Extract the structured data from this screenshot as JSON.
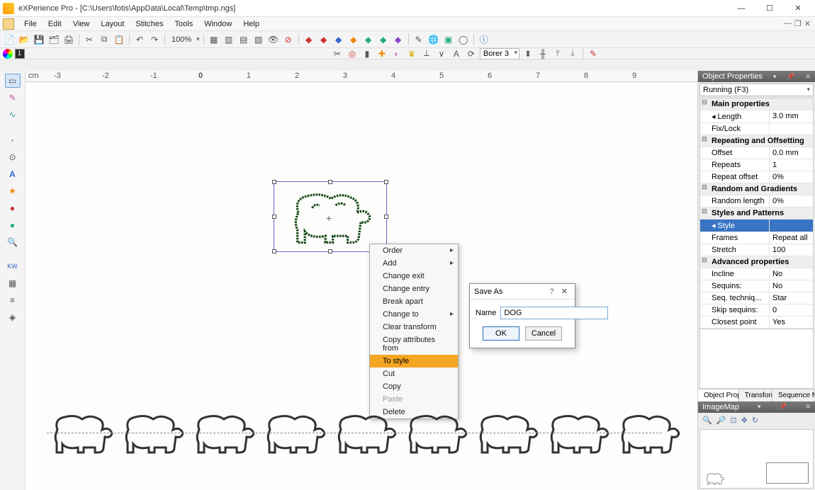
{
  "title": "eXPerience Pro - [C:\\Users\\fotis\\AppData\\Local\\Temp\\tmp.ngs]",
  "menu": [
    "File",
    "Edit",
    "View",
    "Layout",
    "Stitches",
    "Tools",
    "Window",
    "Help"
  ],
  "toolbar1": {
    "zoom": "100%",
    "icons": [
      "new",
      "open",
      "save",
      "saveall",
      "print",
      "cut",
      "copy",
      "paste",
      "undo",
      "redo"
    ],
    "right_icons": [
      "grid1",
      "grid2",
      "grid3",
      "grid4",
      "preview",
      "hide",
      "diamond-red",
      "diamond-blue",
      "diamond-green",
      "diamond-purple",
      "dot",
      "dot2",
      "wand",
      "world",
      "cube",
      "circle",
      "info"
    ]
  },
  "toolbar2": {
    "dropdown": "Borer 3",
    "icons": [
      "scissors",
      "target",
      "lock",
      "cross",
      "mirror",
      "crown",
      "align1",
      "align2",
      "text",
      "rotate",
      "stitch",
      "needle1",
      "needle2",
      "needle3",
      "needle4",
      "color"
    ]
  },
  "colorbar": {
    "swatch": "#2a2a2a",
    "index": "1"
  },
  "ruler": {
    "unit": "cm",
    "marks": [
      "-3",
      "-2",
      "-1",
      "0",
      "1",
      "2",
      "3",
      "4",
      "5",
      "6",
      "7",
      "8",
      "9"
    ]
  },
  "context_menu": [
    {
      "label": "Order",
      "sub": true
    },
    {
      "label": "Add",
      "sub": true
    },
    {
      "label": "Change exit"
    },
    {
      "label": "Change entry"
    },
    {
      "label": "Break apart"
    },
    {
      "label": "Change to",
      "sub": true
    },
    {
      "label": "Clear transform"
    },
    {
      "label": "Copy attributes from"
    },
    {
      "label": "To style",
      "hi": true
    },
    {
      "label": "Cut"
    },
    {
      "label": "Copy"
    },
    {
      "label": "Paste",
      "disabled": true
    },
    {
      "label": "Delete"
    }
  ],
  "dialog": {
    "title": "Save As",
    "name_label": "Name",
    "name_value": "DOG",
    "ok": "OK",
    "cancel": "Cancel"
  },
  "props": {
    "panel_title": "Object Properties",
    "mode": "Running (F3)",
    "rows": [
      {
        "section": "Main properties"
      },
      {
        "k": "Length",
        "v": "3.0 mm",
        "icon": true
      },
      {
        "k": "Fix/Lock",
        "v": "<none>"
      },
      {
        "section": "Repeating and Offsetting"
      },
      {
        "k": "Offset",
        "v": "0.0 mm"
      },
      {
        "k": "Repeats",
        "v": "1"
      },
      {
        "k": "Repeat offset",
        "v": "0%"
      },
      {
        "section": "Random and Gradients"
      },
      {
        "k": "Random length",
        "v": "0%"
      },
      {
        "section": "Styles and Patterns"
      },
      {
        "k": "Style",
        "v": "<none>",
        "sel": true,
        "icon": true
      },
      {
        "k": "Frames",
        "v": "Repeat all"
      },
      {
        "k": "Stretch",
        "v": "100"
      },
      {
        "section": "Advanced properties"
      },
      {
        "k": "Incline",
        "v": "No"
      },
      {
        "k": "Sequins:",
        "v": "No"
      },
      {
        "k": "Seq. techniq...",
        "v": "Star"
      },
      {
        "k": "Skip sequins:",
        "v": "0"
      },
      {
        "k": "Closest point",
        "v": "Yes"
      }
    ],
    "tabs": [
      "Object Prop...",
      "Transform",
      "Sequence M..."
    ],
    "imagemap_title": "ImageMap"
  }
}
